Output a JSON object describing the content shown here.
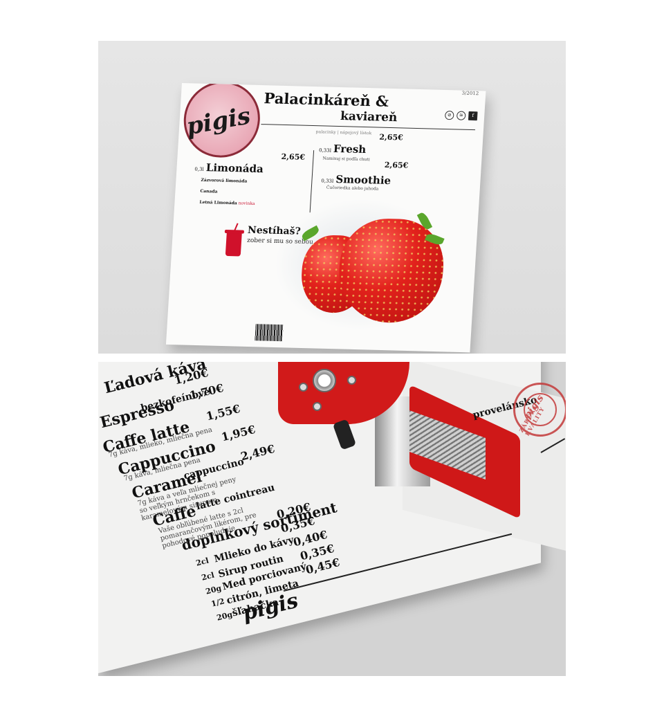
{
  "cover": {
    "logo": "pigis",
    "title_line1": "Palacinkáreň &",
    "title_line2": "kaviareň",
    "issue": "3/2012",
    "tagline": "palacinky | nápojový lístok",
    "items": [
      {
        "vol": "0,3l",
        "name": "Limonáda",
        "price": "2,65€"
      },
      {
        "vol": "0,33l",
        "name": "Fresh",
        "price": "2,65€"
      },
      {
        "vol": "0,33l",
        "name": "Smoothie",
        "price": "2,65€"
      }
    ],
    "limonada_notes": [
      "Zázvorová limonáda",
      "Canada",
      "Letná Limonáda"
    ],
    "fresh_note": "Namixuj si podľa chuti",
    "smoothie_note": "Čučoriedka alebo jahoda",
    "letna_badge": "novinka",
    "promo_title": "Nestíhaš?",
    "promo_sub": "zober si mu so sebou"
  },
  "spread": {
    "items": [
      {
        "name": "Ľadová káva",
        "price": "1,20€"
      },
      {
        "name": "Espresso",
        "sub": "bezkofeínové",
        "price": "1,70€"
      },
      {
        "name": "Caffe latte",
        "price": "1,55€"
      },
      {
        "name": "Cappuccino",
        "price": "1,95€"
      },
      {
        "name": "Caramel",
        "sub": "cappuccino",
        "price": "2,49€"
      },
      {
        "name": "Caffe",
        "sub": "latte cointreau",
        "price": ""
      }
    ],
    "descs": {
      "caffe_latte": "7g káva, mlieko, mliečna pena",
      "cappuccino": "7g káva, mliečna pena",
      "caramel": "7g káva a veľa mliečnej peny so veľkým hrnčekom s karamelovým sirupom",
      "cointreau": "Vaše obľúbené latte s 2cl pomarančovým likérom, pre pohodové popoludnie"
    },
    "section": "doplnkový sortiment",
    "extras": [
      {
        "qty": "2cl",
        "name": "Mlieko do kávy",
        "price": "0,20€"
      },
      {
        "qty": "2cl",
        "name": "Sirup routin",
        "price": "0,35€"
      },
      {
        "qty": "20g",
        "name": "Med porciovaný",
        "price": "0,40€"
      },
      {
        "qty": "1/2",
        "name": "citrón, limeta",
        "price": "0,35€"
      },
      {
        "qty": "20g",
        "name": "šľahačka",
        "price": "0,45€"
      }
    ],
    "logo": "pigis",
    "stamp_logo": "pigis",
    "stamp_ring": "ZÁRUKA KVALITY",
    "right_page_item": "provelánsko"
  }
}
